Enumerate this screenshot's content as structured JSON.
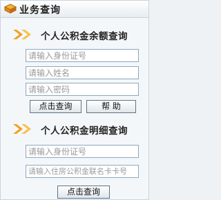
{
  "header": {
    "title": "业务查询",
    "icon": "book-icon"
  },
  "balance_query": {
    "title": "个人公积金余额查询",
    "id_placeholder": "请输入身份证号",
    "name_placeholder": "请输入姓名",
    "password_placeholder": "请输入密码",
    "query_label": "点击查询",
    "help_label": "帮  助"
  },
  "detail_query": {
    "title": "个人公积金明细查询",
    "id_placeholder": "请输入身份证号",
    "card_placeholder": "请输入住房公积金联名卡卡号",
    "query_label": "点击查询"
  },
  "colors": {
    "accent_orange": "#f0a020",
    "border_blue": "#8aa8c0"
  }
}
